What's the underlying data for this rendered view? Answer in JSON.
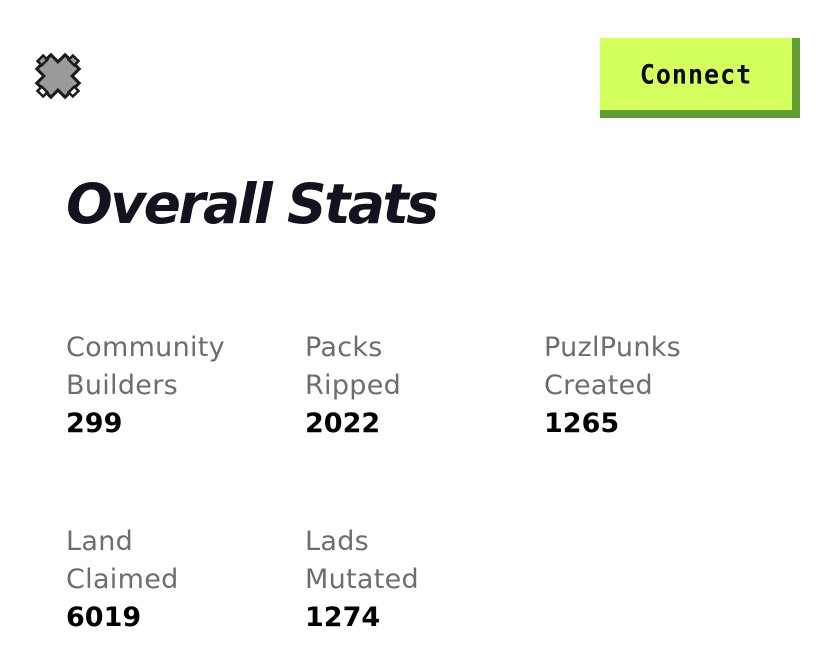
{
  "header": {
    "logo_icon": "puzzle-piece-icon",
    "connect_label": "Connect",
    "connect_color": "#d5ff5c",
    "connect_shadow_color": "#5f9e2f"
  },
  "main": {
    "title": "Overall Stats",
    "stats": [
      {
        "label_line1": "Community",
        "label_line2": "Builders",
        "value": "299"
      },
      {
        "label_line1": "Packs",
        "label_line2": "Ripped",
        "value": "2022"
      },
      {
        "label_line1": "PuzlPunks",
        "label_line2": "Created",
        "value": "1265"
      },
      {
        "label_line1": "Land",
        "label_line2": "Claimed",
        "value": "6019"
      },
      {
        "label_line1": "Lads",
        "label_line2": "Mutated",
        "value": "1274"
      }
    ]
  }
}
